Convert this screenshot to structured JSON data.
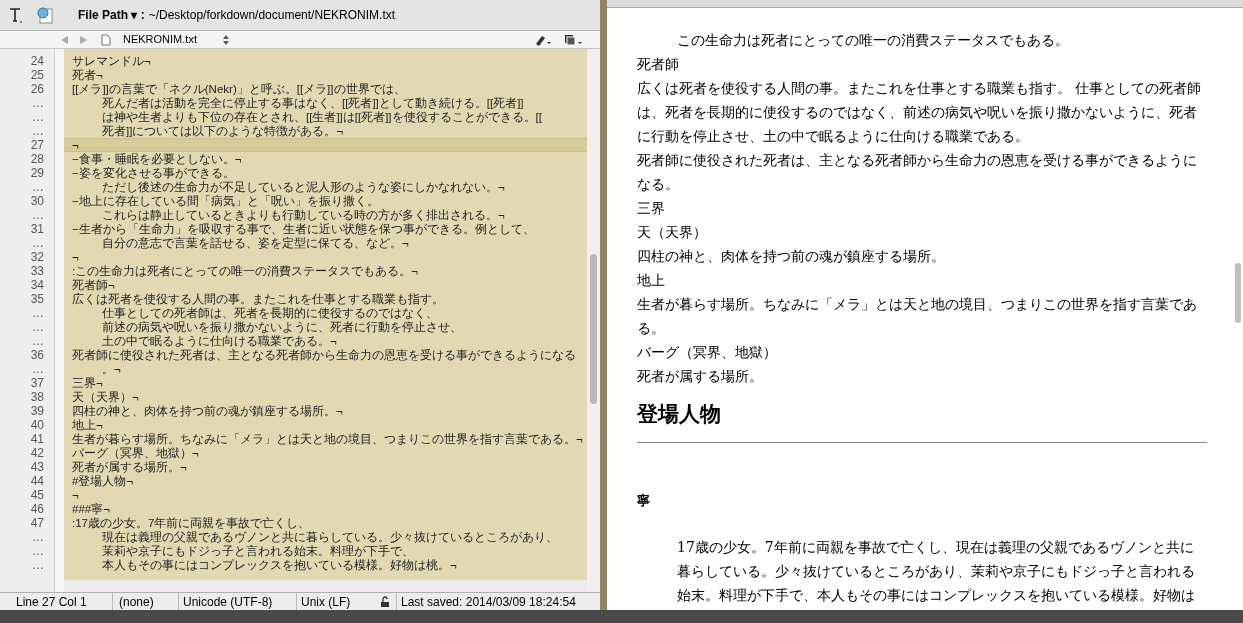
{
  "toolbar": {
    "file_path_label": "File Path ▾ :",
    "file_path": "~/Desktop/forkdown/document/NEKRONIM.txt"
  },
  "tab": {
    "name": "NEKRONIM.txt"
  },
  "editor": {
    "lines": [
      {
        "gutter": "24",
        "text": "サレマンドル¬",
        "current": false,
        "wrapped": false
      },
      {
        "gutter": "25",
        "text": "死者¬",
        "current": false,
        "wrapped": false
      },
      {
        "gutter": "26",
        "text": "[[メラ]]の言葉で「ネクル(Nekr)」と呼ぶ。[[メラ]]の世界では、",
        "current": false,
        "wrapped": false
      },
      {
        "gutter": "…",
        "text": "死んだ者は活動を完全に停止する事はなく、[[死者]]として動き続ける。[[死者]]",
        "current": false,
        "wrapped": true
      },
      {
        "gutter": "…",
        "text": "は神や生者よりも下位の存在とされ、[[生者]]は[[死者]]を使役することができる。[[",
        "current": false,
        "wrapped": true
      },
      {
        "gutter": "…",
        "text": "死者]]については以下のような特徴がある。¬",
        "current": false,
        "wrapped": true
      },
      {
        "gutter": "27",
        "text": "¬",
        "current": true,
        "wrapped": false
      },
      {
        "gutter": "28",
        "text": "−食事・睡眠を必要としない。¬",
        "current": false,
        "wrapped": false
      },
      {
        "gutter": "29",
        "text": "−姿を変化させる事ができる。",
        "current": false,
        "wrapped": false
      },
      {
        "gutter": "…",
        "text": "ただし後述の生命力が不足していると泥人形のような姿にしかなれない。¬",
        "current": false,
        "wrapped": true
      },
      {
        "gutter": "30",
        "text": "−地上に存在している間「病気」と「呪い」を振り撒く。",
        "current": false,
        "wrapped": false
      },
      {
        "gutter": "…",
        "text": "これらは静止しているときよりも行動している時の方が多く排出される。¬",
        "current": false,
        "wrapped": true
      },
      {
        "gutter": "31",
        "text": "−生者から「生命力」を吸収する事で、生者に近い状態を保つ事ができる。例として、",
        "current": false,
        "wrapped": false
      },
      {
        "gutter": "…",
        "text": "自分の意志で言葉を話せる、姿を定型に保てる、など。¬",
        "current": false,
        "wrapped": true
      },
      {
        "gutter": "32",
        "text": "¬",
        "current": false,
        "wrapped": false
      },
      {
        "gutter": "33",
        "text": ":この生命力は死者にとっての唯一の消費ステータスでもある。¬",
        "current": false,
        "wrapped": false
      },
      {
        "gutter": "34",
        "text": "死者師¬",
        "current": false,
        "wrapped": false
      },
      {
        "gutter": "35",
        "text": "広くは死者を使役する人間の事。またこれを仕事とする職業も指す。",
        "current": false,
        "wrapped": false
      },
      {
        "gutter": "…",
        "text": "仕事としての死者師は、死者を長期的に使役するのではなく、",
        "current": false,
        "wrapped": true
      },
      {
        "gutter": "…",
        "text": "前述の病気や呪いを振り撒かないように、死者に行動を停止させ、",
        "current": false,
        "wrapped": true
      },
      {
        "gutter": "…",
        "text": "土の中で眠るように仕向ける職業である。¬",
        "current": false,
        "wrapped": true
      },
      {
        "gutter": "36",
        "text": "死者師に使役された死者は、主となる死者師から生命力の恩恵を受ける事ができるようになる",
        "current": false,
        "wrapped": false
      },
      {
        "gutter": "…",
        "text": "。¬",
        "current": false,
        "wrapped": true
      },
      {
        "gutter": "37",
        "text": "三界¬",
        "current": false,
        "wrapped": false
      },
      {
        "gutter": "38",
        "text": "天（天界）¬",
        "current": false,
        "wrapped": false
      },
      {
        "gutter": "39",
        "text": "四柱の神と、肉体を持つ前の魂が鎮座する場所。¬",
        "current": false,
        "wrapped": false
      },
      {
        "gutter": "40",
        "text": "地上¬",
        "current": false,
        "wrapped": false
      },
      {
        "gutter": "41",
        "text": "生者が暮らす場所。ちなみに「メラ」とは天と地の境目、つまりこの世界を指す言葉である。¬",
        "current": false,
        "wrapped": false
      },
      {
        "gutter": "42",
        "text": "バーグ（冥界、地獄）¬",
        "current": false,
        "wrapped": false
      },
      {
        "gutter": "43",
        "text": "死者が属する場所。¬",
        "current": false,
        "wrapped": false
      },
      {
        "gutter": "44",
        "text": "#登場人物¬",
        "current": false,
        "wrapped": false
      },
      {
        "gutter": "45",
        "text": "¬",
        "current": false,
        "wrapped": false
      },
      {
        "gutter": "46",
        "text": "###寧¬",
        "current": false,
        "wrapped": false
      },
      {
        "gutter": "47",
        "text": ":17歳の少女。7年前に両親を事故で亡くし、",
        "current": false,
        "wrapped": false
      },
      {
        "gutter": "…",
        "text": "現在は義理の父親であるヴノンと共に暮らしている。少々抜けているところがあり、",
        "current": false,
        "wrapped": true
      },
      {
        "gutter": "…",
        "text": "茉莉や京子にもドジっ子と言われる始末。料理が下手で、",
        "current": false,
        "wrapped": true
      },
      {
        "gutter": "…",
        "text": "本人もその事にはコンプレックスを抱いている模様。好物は桃。¬",
        "current": false,
        "wrapped": true
      }
    ]
  },
  "status_bar": {
    "position": "Line 27 Col 1",
    "syntax": "(none)",
    "encoding": "Unicode (UTF-8)",
    "line_endings": "Unix (LF)",
    "saved": "Last saved: 2014/03/09 18:24:54"
  },
  "preview": {
    "blocks": [
      {
        "kind": "dd",
        "text": "この生命力は死者にとっての唯一の消費ステータスでもある。"
      },
      {
        "kind": "p",
        "text": "死者師"
      },
      {
        "kind": "p",
        "text": "広くは死者を使役する人間の事。またこれを仕事とする職業も指す。 仕事としての死者師は、死者を長期的に使役するのではなく、前述の病気や呪いを振り撒かないように、死者に行動を停止させ、土の中で眠るように仕向ける職業である。"
      },
      {
        "kind": "p",
        "text": "死者師に使役された死者は、主となる死者師から生命力の恩恵を受ける事ができるようになる。"
      },
      {
        "kind": "p",
        "text": "三界"
      },
      {
        "kind": "p",
        "text": "天（天界）"
      },
      {
        "kind": "p",
        "text": "四柱の神と、肉体を持つ前の魂が鎮座する場所。"
      },
      {
        "kind": "p",
        "text": "地上"
      },
      {
        "kind": "p",
        "text": "生者が暮らす場所。ちなみに「メラ」とは天と地の境目、つまりこの世界を指す言葉である。"
      },
      {
        "kind": "p",
        "text": "バーグ（冥界、地獄）"
      },
      {
        "kind": "p",
        "text": "死者が属する場所。"
      },
      {
        "kind": "h1",
        "text": "登場人物"
      },
      {
        "kind": "hr"
      },
      {
        "kind": "h3",
        "text": "寧"
      },
      {
        "kind": "dd",
        "text": "17歳の少女。7年前に両親を事故で亡くし、現在は義理の父親であるヴノンと共に暮らしている。少々抜けているところがあり、茉莉や京子にもドジっ子と言われる始末。料理が下手で、本人もその事にはコンプレックスを抱いている模様。好物は"
      }
    ]
  }
}
